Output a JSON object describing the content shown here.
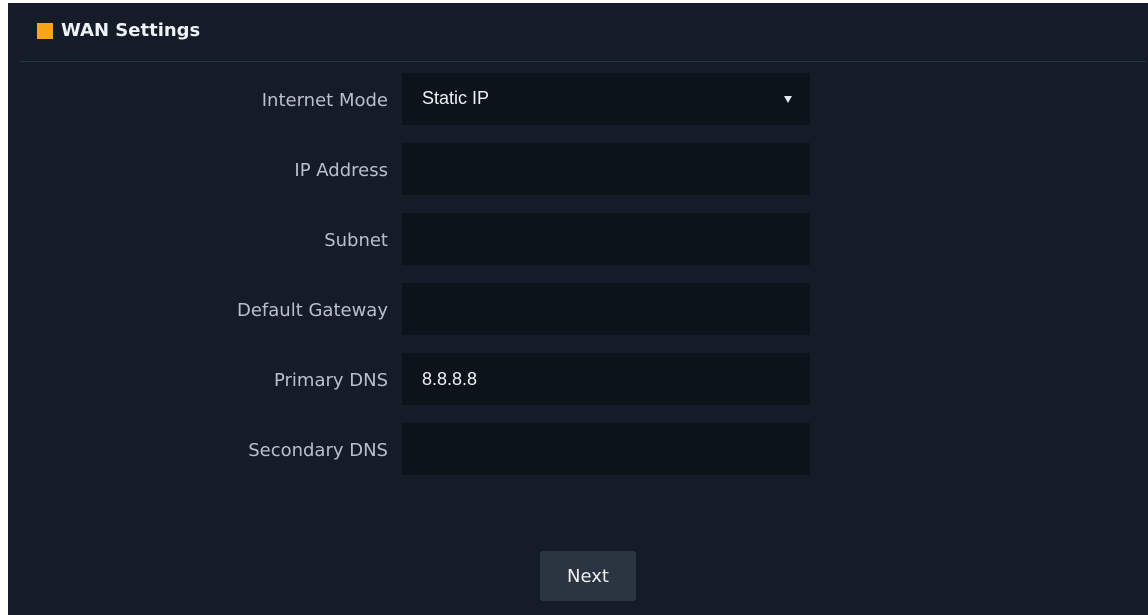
{
  "header": {
    "title": "WAN Settings",
    "accent_color": "#f6a616"
  },
  "form": {
    "internet_mode": {
      "label": "Internet Mode",
      "value": "Static IP"
    },
    "ip_address": {
      "label": "IP Address",
      "value": ""
    },
    "subnet": {
      "label": "Subnet",
      "value": ""
    },
    "default_gateway": {
      "label": "Default Gateway",
      "value": ""
    },
    "primary_dns": {
      "label": "Primary DNS",
      "value": "8.8.8.8"
    },
    "secondary_dns": {
      "label": "Secondary DNS",
      "value": ""
    }
  },
  "actions": {
    "next_label": "Next"
  },
  "colors": {
    "panel_background": "#141c27",
    "field_background": "#0d131b",
    "button_background": "#2b3441"
  }
}
